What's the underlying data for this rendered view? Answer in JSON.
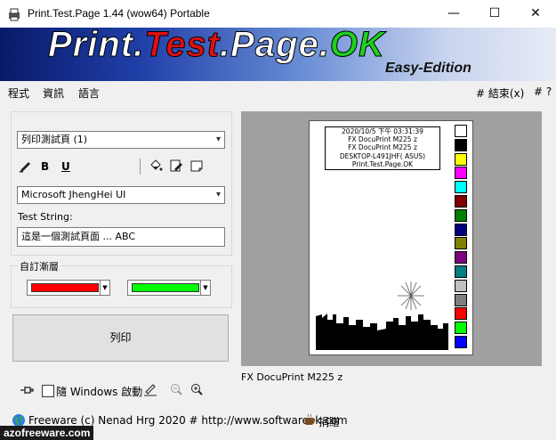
{
  "window": {
    "title": "Print.Test.Page 1.44  (wow64) Portable",
    "minimize": "—",
    "maximize": "☐",
    "close": "✕"
  },
  "banner": {
    "logo_parts": [
      "Print",
      ".",
      "Test",
      ".",
      "Page",
      ".",
      "OK"
    ],
    "subtitle": "Easy-Edition"
  },
  "menu": {
    "items": [
      "程式",
      "資訊",
      "語言"
    ],
    "right": [
      "# 結束(x)",
      "# ?"
    ]
  },
  "controls": {
    "mode_select": "列印測試頁 (1)",
    "font_style_buttons": [
      "B",
      "U"
    ],
    "font_select": "Microsoft JhengHei UI",
    "test_string_label": "Test String:",
    "test_string_value": "這是一個測試頁面 ... ABC",
    "custom_layer_label": "自訂漸層",
    "color1": "#ff0000",
    "color2": "#00ff00",
    "print_label": "列印"
  },
  "preview": {
    "info_lines": [
      "2020/10/5 下午 03:31:39",
      "FX DocuPrint M225 z",
      "FX DocuPrint M225 z",
      "DESKTOP-L491JHF( ASUS)",
      "Print.Test.Page.OK"
    ],
    "palette_colors": [
      "#ffffff",
      "#000000",
      "#ffff00",
      "#ff00ff",
      "#00ffff",
      "#800000",
      "#008000",
      "#000080",
      "#808000",
      "#800080",
      "#008080",
      "#c0c0c0",
      "#808080",
      "#ff0000",
      "#00ff00",
      "#0000ff"
    ],
    "caption": "FX DocuPrint M225 z"
  },
  "bottom": {
    "autostart_label": "隨 Windows 啟動"
  },
  "status": {
    "text": "Freeware (c) Nenad Hrg 2020 # http://www.softwareok.com",
    "donate": "捐贈"
  },
  "watermark": "azofreeware.com"
}
